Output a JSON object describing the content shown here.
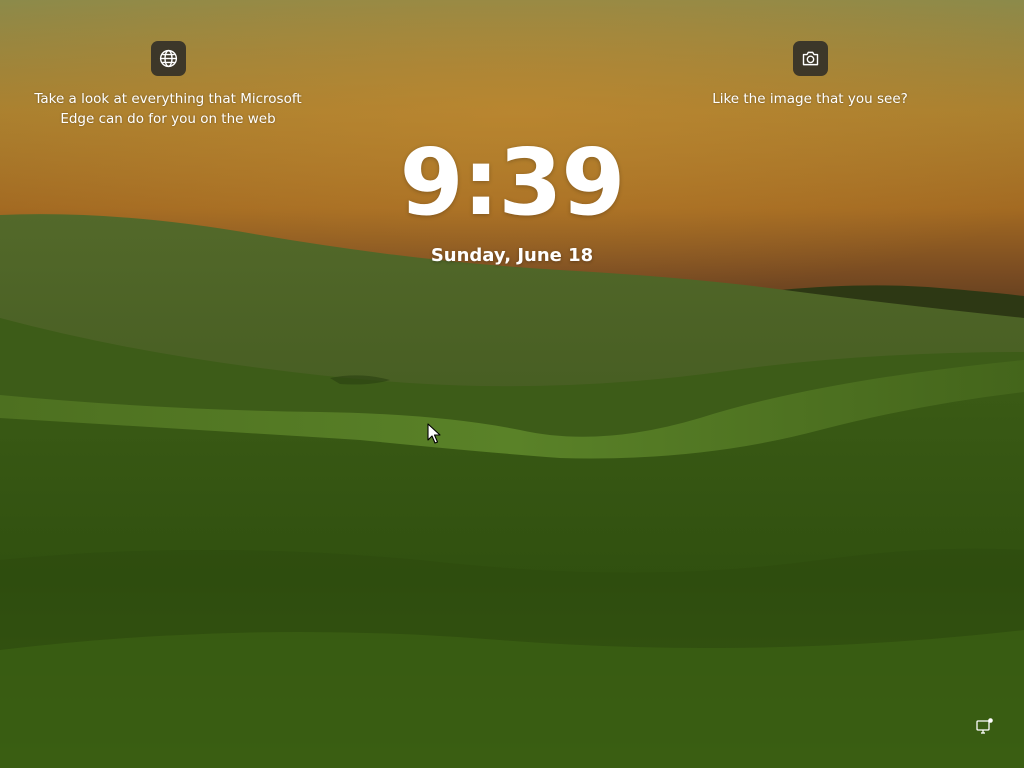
{
  "lock_screen": {
    "time": "9:39",
    "date": "Sunday, June 18"
  },
  "widgets": {
    "left": {
      "icon": "globe-icon",
      "text": "Take a look at everything that Microsoft Edge can do for you on the web"
    },
    "right": {
      "icon": "camera-icon",
      "text": "Like the image that you see?"
    }
  },
  "status": {
    "network_icon": "network-icon"
  },
  "colors": {
    "sky_top": "#8a8040",
    "sky_mid": "#b07a28",
    "sky_horizon": "#7a4a1e",
    "hill_light": "#4f7a22",
    "hill_dark": "#2a4210",
    "widget_bg": "#262626"
  }
}
